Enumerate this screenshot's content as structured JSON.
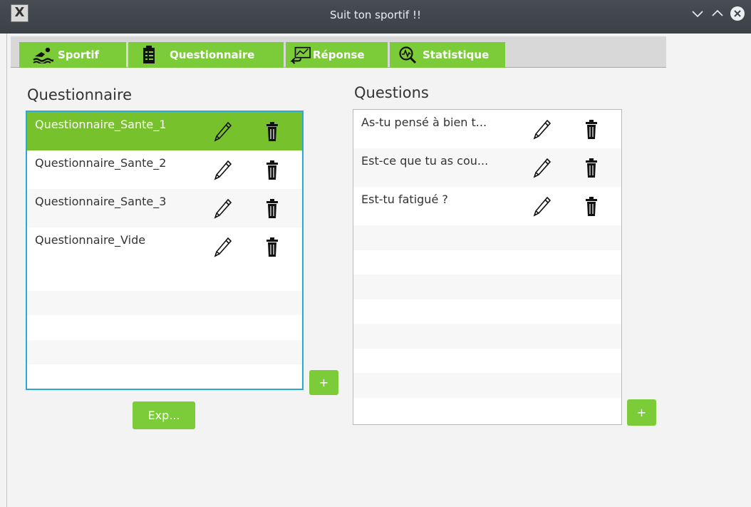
{
  "window": {
    "title": "Suit ton sportif !!",
    "app_icon_glyph": "X",
    "controls": [
      "minimize-icon",
      "maximize-icon",
      "close-icon"
    ]
  },
  "tabs": [
    {
      "label": "Sportif",
      "icon": "swimmer-icon",
      "active": false
    },
    {
      "label": "Questionnaire",
      "icon": "clipboard-icon",
      "active": true
    },
    {
      "label": "Réponse",
      "icon": "reply-chart-icon",
      "active": false
    },
    {
      "label": "Statistique",
      "icon": "magnifier-chart-icon",
      "active": false
    }
  ],
  "questionnaires": {
    "title": "Questionnaire",
    "items": [
      {
        "label": "Questionnaire_Sante_1",
        "selected": true
      },
      {
        "label": "Questionnaire_Sante_2",
        "selected": false
      },
      {
        "label": "Questionnaire_Sante_3",
        "selected": false
      },
      {
        "label": "Questionnaire_Vide",
        "selected": false
      }
    ],
    "add_label": "+",
    "export_label": "Exp..."
  },
  "questions": {
    "title": "Questions",
    "items": [
      {
        "label": "As-tu pensé à bien t..."
      },
      {
        "label": "Est-ce que tu as cou..."
      },
      {
        "label": "Est-tu fatigué ?"
      }
    ],
    "add_label": "+"
  },
  "colors": {
    "accent_green": "#7ccc3a",
    "selected_green": "#77c22c",
    "focus_border": "#2aa8d6",
    "titlebar": "#41454b"
  },
  "row_icons": {
    "edit": "pencil-icon",
    "delete": "trash-icon"
  }
}
